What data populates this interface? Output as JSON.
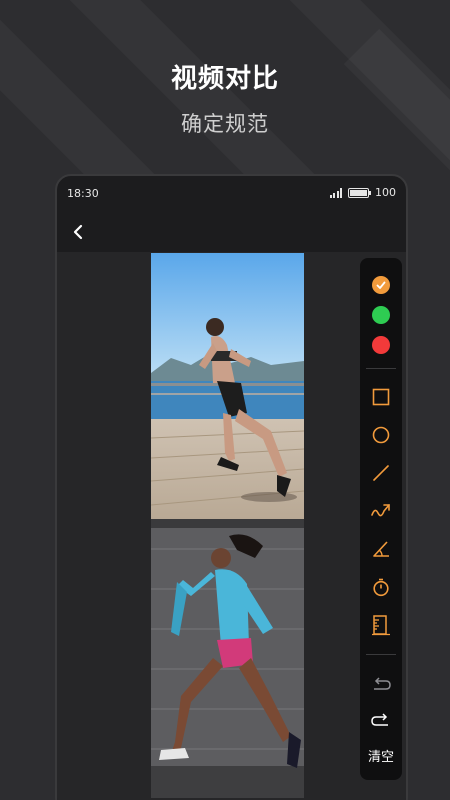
{
  "promo": {
    "title": "视频对比",
    "subtitle": "确定规范"
  },
  "statusbar": {
    "time": "18:30",
    "battery": "100"
  },
  "toolbar": {
    "colors": [
      {
        "name": "orange",
        "hex": "#f29b3c",
        "selected": true
      },
      {
        "name": "green",
        "hex": "#2ecc52",
        "selected": false
      },
      {
        "name": "red",
        "hex": "#f23a3a",
        "selected": false
      }
    ],
    "accent": "#f29b3c",
    "tools": [
      "rectangle-icon",
      "circle-icon",
      "line-icon",
      "freehand-arrow-icon",
      "angle-icon",
      "stopwatch-icon",
      "ruler-icon"
    ],
    "undo_icon": "undo-icon",
    "redo_icon": "redo-icon",
    "clear_label": "清空"
  }
}
